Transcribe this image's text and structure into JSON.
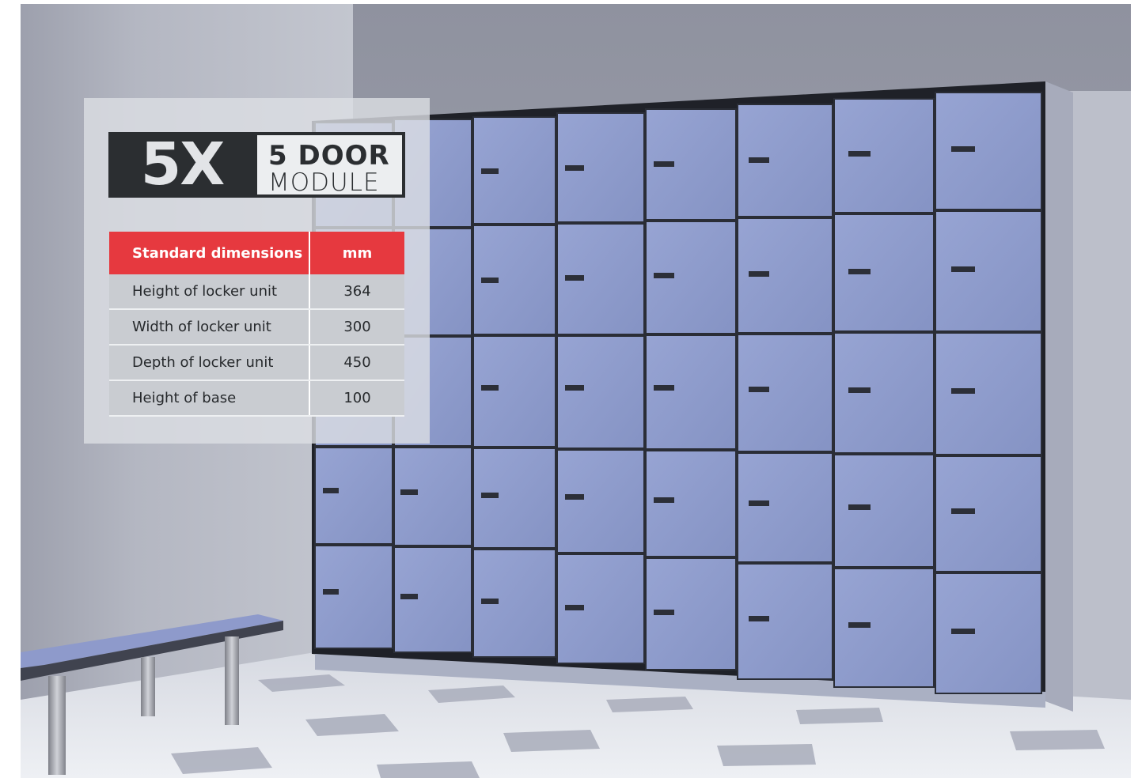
{
  "module": {
    "code": "5X",
    "title": "5 DOOR",
    "subtitle": "MODULE"
  },
  "spec_table": {
    "header": {
      "label": "Standard dimensions",
      "unit": "mm"
    },
    "rows": [
      {
        "label": "Height of locker unit",
        "value": "364"
      },
      {
        "label": "Width of locker unit",
        "value": "300"
      },
      {
        "label": "Depth of locker unit",
        "value": "450"
      },
      {
        "label": "Height of base",
        "value": "100"
      }
    ]
  },
  "colors": {
    "header_red": "#e6393f",
    "badge_dark": "#2b2e31",
    "row_grey": "#c9ccd1",
    "locker_blue": "#8e9ccb"
  }
}
